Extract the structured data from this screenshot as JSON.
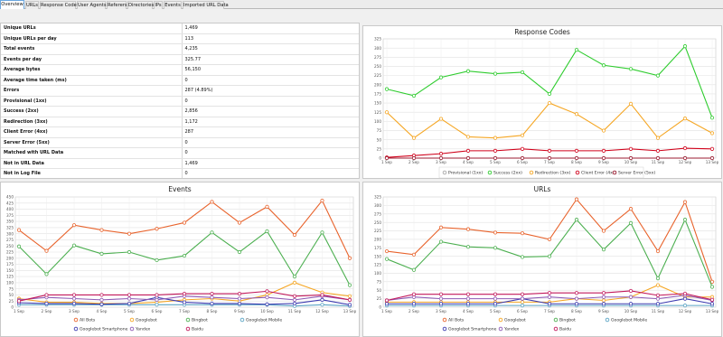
{
  "tabs": [
    "Overview",
    "URLs",
    "Response Codes",
    "User Agents",
    "Referers",
    "Directories",
    "IPs",
    "Events",
    "Imported URL Data"
  ],
  "summary": [
    {
      "label": "Unique URLs",
      "value": "1,469"
    },
    {
      "label": "Unique URLs per day",
      "value": "113"
    },
    {
      "label": "Total events",
      "value": "4,235"
    },
    {
      "label": "Events per day",
      "value": "325.77"
    },
    {
      "label": "Average bytes",
      "value": "56,150"
    },
    {
      "label": "Average time taken (ms)",
      "value": "0"
    },
    {
      "label": "Errors",
      "value": "287 (4.89%)"
    },
    {
      "label": "Provisional (1xx)",
      "value": "0"
    },
    {
      "label": "Success (2xx)",
      "value": "2,856"
    },
    {
      "label": "Redirection (3xx)",
      "value": "1,172"
    },
    {
      "label": "Client Error (4xx)",
      "value": "287"
    },
    {
      "label": "Server Error (5xx)",
      "value": "0"
    },
    {
      "label": "Matched with URL Data",
      "value": "0"
    },
    {
      "label": "Not in URL Data",
      "value": "1,469"
    },
    {
      "label": "Not in Log File",
      "value": "0"
    }
  ],
  "chart_data": [
    {
      "id": "codes",
      "type": "line",
      "title": "Response Codes",
      "categories": [
        "1 Sep",
        "2 Sep",
        "3 Sep",
        "4 Sep",
        "5 Sep",
        "6 Sep",
        "7 Sep",
        "8 Sep",
        "9 Sep",
        "10 Sep",
        "11 Sep",
        "12 Sep",
        "13 Sep"
      ],
      "ylim": [
        0,
        325
      ],
      "yticks": [
        0,
        25,
        50,
        75,
        100,
        125,
        150,
        175,
        200,
        225,
        250,
        275,
        300,
        325
      ],
      "grid": true,
      "legend_position": "bottom",
      "series": [
        {
          "name": "Provisional (1xx)",
          "color": "#a8a8a8",
          "values": [
            0,
            0,
            0,
            0,
            0,
            0,
            0,
            0,
            0,
            0,
            0,
            0,
            0
          ]
        },
        {
          "name": "Success (2xx)",
          "color": "#2ecc2e",
          "values": [
            188,
            170,
            220,
            237,
            230,
            234,
            175,
            295,
            253,
            243,
            225,
            305,
            110
          ]
        },
        {
          "name": "Redirection (3xx)",
          "color": "#f5a623",
          "values": [
            125,
            55,
            107,
            58,
            55,
            62,
            150,
            120,
            75,
            148,
            55,
            108,
            68
          ]
        },
        {
          "name": "Client Error (4xx)",
          "color": "#d0021b",
          "values": [
            2,
            7,
            12,
            20,
            20,
            25,
            20,
            20,
            20,
            25,
            20,
            27,
            25
          ]
        },
        {
          "name": "Server Error (5xx)",
          "color": "#9b1b30",
          "values": [
            0,
            0,
            0,
            0,
            0,
            0,
            0,
            0,
            0,
            0,
            0,
            0,
            0
          ]
        }
      ]
    },
    {
      "id": "events",
      "type": "line",
      "title": "Events",
      "categories": [
        "1 Sep",
        "2 Sep",
        "3 Sep",
        "4 Sep",
        "5 Sep",
        "6 Sep",
        "7 Sep",
        "8 Sep",
        "9 Sep",
        "10 Sep",
        "11 Sep",
        "12 Sep",
        "13 Sep"
      ],
      "ylim": [
        0,
        450
      ],
      "yticks": [
        0,
        25,
        50,
        75,
        100,
        125,
        150,
        175,
        200,
        225,
        250,
        275,
        300,
        325,
        350,
        375,
        400,
        425,
        450
      ],
      "grid": true,
      "legend_position": "bottom",
      "series": [
        {
          "name": "All Bots",
          "color": "#e8632c",
          "values": [
            315,
            230,
            335,
            315,
            300,
            320,
            345,
            430,
            345,
            410,
            295,
            435,
            200
          ]
        },
        {
          "name": "Googlebot",
          "color": "#f5a623",
          "values": [
            35,
            20,
            20,
            15,
            15,
            20,
            30,
            35,
            25,
            50,
            100,
            60,
            45
          ]
        },
        {
          "name": "Bingbot",
          "color": "#4caf50",
          "values": [
            248,
            135,
            252,
            218,
            225,
            192,
            210,
            305,
            225,
            310,
            125,
            305,
            90
          ]
        },
        {
          "name": "Googlebot Mobile",
          "color": "#5ba4c4",
          "values": [
            10,
            10,
            10,
            10,
            10,
            10,
            10,
            10,
            10,
            10,
            5,
            10,
            5
          ]
        },
        {
          "name": "Googlebot Smartphone",
          "color": "#3d3bb0",
          "values": [
            18,
            15,
            15,
            12,
            15,
            40,
            20,
            15,
            15,
            12,
            15,
            30,
            10
          ]
        },
        {
          "name": "Yandex",
          "color": "#8e5bb5",
          "values": [
            30,
            40,
            35,
            30,
            35,
            30,
            45,
            40,
            35,
            40,
            30,
            45,
            30
          ]
        },
        {
          "name": "Baidu",
          "color": "#c2185b",
          "values": [
            25,
            50,
            50,
            50,
            50,
            50,
            55,
            55,
            55,
            65,
            45,
            50,
            30
          ]
        }
      ]
    },
    {
      "id": "urls",
      "type": "line",
      "title": "URLs",
      "categories": [
        "1 Sep",
        "2 Sep",
        "3 Sep",
        "4 Sep",
        "5 Sep",
        "6 Sep",
        "7 Sep",
        "8 Sep",
        "9 Sep",
        "10 Sep",
        "11 Sep",
        "12 Sep",
        "13 Sep"
      ],
      "ylim": [
        0,
        325
      ],
      "yticks": [
        0,
        25,
        50,
        75,
        100,
        125,
        150,
        175,
        200,
        225,
        250,
        275,
        300,
        325
      ],
      "grid": true,
      "legend_position": "bottom",
      "series": [
        {
          "name": "All Bots",
          "color": "#e8632c",
          "values": [
            165,
            155,
            235,
            230,
            220,
            218,
            200,
            318,
            225,
            290,
            165,
            310,
            75
          ]
        },
        {
          "name": "Googlebot",
          "color": "#f5a623",
          "values": [
            15,
            15,
            15,
            15,
            15,
            15,
            15,
            25,
            20,
            30,
            65,
            30,
            30
          ]
        },
        {
          "name": "Bingbot",
          "color": "#4caf50",
          "values": [
            142,
            110,
            193,
            178,
            175,
            148,
            150,
            258,
            170,
            248,
            85,
            258,
            60
          ]
        },
        {
          "name": "Googlebot Mobile",
          "color": "#5ba4c4",
          "values": [
            5,
            5,
            5,
            5,
            5,
            5,
            5,
            5,
            5,
            5,
            5,
            5,
            5
          ]
        },
        {
          "name": "Googlebot Smartphone",
          "color": "#3d3bb0",
          "values": [
            10,
            10,
            10,
            10,
            10,
            25,
            10,
            10,
            10,
            10,
            10,
            25,
            10
          ]
        },
        {
          "name": "Yandex",
          "color": "#8e5bb5",
          "values": [
            20,
            30,
            25,
            25,
            25,
            25,
            30,
            25,
            30,
            30,
            25,
            35,
            20
          ]
        },
        {
          "name": "Baidu",
          "color": "#c2185b",
          "values": [
            20,
            38,
            38,
            38,
            38,
            38,
            42,
            42,
            42,
            48,
            35,
            40,
            22
          ]
        }
      ]
    }
  ]
}
